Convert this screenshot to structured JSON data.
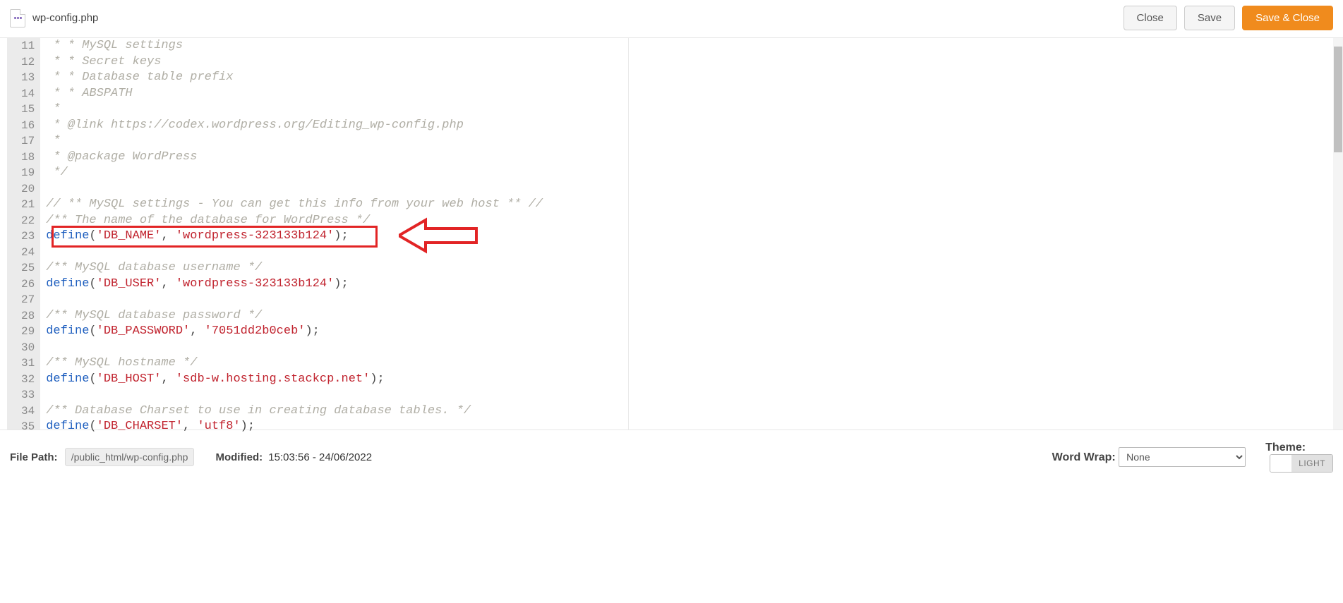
{
  "header": {
    "filename": "wp-config.php",
    "close": "Close",
    "save": "Save",
    "saveclose": "Save & Close"
  },
  "footer": {
    "filePathLabel": "File Path:",
    "filePath": "/public_html/wp-config.php",
    "modifiedLabel": "Modified:",
    "modified": "15:03:56 - 24/06/2022",
    "wordWrapLabel": "Word Wrap:",
    "wordWrapValue": "None",
    "themeLabel": "Theme:",
    "themeLight": "LIGHT"
  },
  "lines": [
    {
      "n": 11,
      "parts": [
        {
          "cls": "tok-comment",
          "t": " * * MySQL settings"
        }
      ]
    },
    {
      "n": 12,
      "parts": [
        {
          "cls": "tok-comment",
          "t": " * * Secret keys"
        }
      ]
    },
    {
      "n": 13,
      "parts": [
        {
          "cls": "tok-comment",
          "t": " * * Database table prefix"
        }
      ]
    },
    {
      "n": 14,
      "parts": [
        {
          "cls": "tok-comment",
          "t": " * * ABSPATH"
        }
      ]
    },
    {
      "n": 15,
      "parts": [
        {
          "cls": "tok-comment",
          "t": " *"
        }
      ]
    },
    {
      "n": 16,
      "parts": [
        {
          "cls": "tok-comment",
          "t": " * @link https://codex.wordpress.org/Editing_wp-config.php"
        }
      ]
    },
    {
      "n": 17,
      "parts": [
        {
          "cls": "tok-comment",
          "t": " *"
        }
      ]
    },
    {
      "n": 18,
      "parts": [
        {
          "cls": "tok-comment",
          "t": " * @package WordPress"
        }
      ]
    },
    {
      "n": 19,
      "parts": [
        {
          "cls": "tok-comment",
          "t": " */"
        }
      ]
    },
    {
      "n": 20,
      "parts": []
    },
    {
      "n": 21,
      "parts": [
        {
          "cls": "tok-comment",
          "t": "// ** MySQL settings - You can get this info from your web host ** //"
        }
      ]
    },
    {
      "n": 22,
      "parts": [
        {
          "cls": "tok-comment",
          "t": "/** The name of the database for WordPress */"
        }
      ]
    },
    {
      "n": 23,
      "parts": [
        {
          "cls": "tok-keyword",
          "t": "define"
        },
        {
          "cls": "tok-plain",
          "t": "("
        },
        {
          "cls": "tok-string",
          "t": "'DB_NAME'"
        },
        {
          "cls": "tok-plain",
          "t": ", "
        },
        {
          "cls": "tok-string",
          "t": "'wordpress-323133b124'"
        },
        {
          "cls": "tok-plain",
          "t": ");"
        }
      ]
    },
    {
      "n": 24,
      "parts": []
    },
    {
      "n": 25,
      "parts": [
        {
          "cls": "tok-comment",
          "t": "/** MySQL database username */"
        }
      ]
    },
    {
      "n": 26,
      "parts": [
        {
          "cls": "tok-keyword",
          "t": "define"
        },
        {
          "cls": "tok-plain",
          "t": "("
        },
        {
          "cls": "tok-string",
          "t": "'DB_USER'"
        },
        {
          "cls": "tok-plain",
          "t": ", "
        },
        {
          "cls": "tok-string",
          "t": "'wordpress-323133b124'"
        },
        {
          "cls": "tok-plain",
          "t": ");"
        }
      ]
    },
    {
      "n": 27,
      "parts": []
    },
    {
      "n": 28,
      "parts": [
        {
          "cls": "tok-comment",
          "t": "/** MySQL database password */"
        }
      ]
    },
    {
      "n": 29,
      "parts": [
        {
          "cls": "tok-keyword",
          "t": "define"
        },
        {
          "cls": "tok-plain",
          "t": "("
        },
        {
          "cls": "tok-string",
          "t": "'DB_PASSWORD'"
        },
        {
          "cls": "tok-plain",
          "t": ", "
        },
        {
          "cls": "tok-string",
          "t": "'7051dd2b0ceb'"
        },
        {
          "cls": "tok-plain",
          "t": ");"
        }
      ]
    },
    {
      "n": 30,
      "parts": []
    },
    {
      "n": 31,
      "parts": [
        {
          "cls": "tok-comment",
          "t": "/** MySQL hostname */"
        }
      ]
    },
    {
      "n": 32,
      "parts": [
        {
          "cls": "tok-keyword",
          "t": "define"
        },
        {
          "cls": "tok-plain",
          "t": "("
        },
        {
          "cls": "tok-string",
          "t": "'DB_HOST'"
        },
        {
          "cls": "tok-plain",
          "t": ", "
        },
        {
          "cls": "tok-string",
          "t": "'sdb-w.hosting.stackcp.net'"
        },
        {
          "cls": "tok-plain",
          "t": ");"
        }
      ]
    },
    {
      "n": 33,
      "parts": []
    },
    {
      "n": 34,
      "parts": [
        {
          "cls": "tok-comment",
          "t": "/** Database Charset to use in creating database tables. */"
        }
      ]
    },
    {
      "n": 35,
      "parts": [
        {
          "cls": "tok-keyword",
          "t": "define"
        },
        {
          "cls": "tok-plain",
          "t": "("
        },
        {
          "cls": "tok-string",
          "t": "'DB_CHARSET'"
        },
        {
          "cls": "tok-plain",
          "t": ", "
        },
        {
          "cls": "tok-string",
          "t": "'utf8'"
        },
        {
          "cls": "tok-plain",
          "t": ");"
        }
      ]
    }
  ]
}
